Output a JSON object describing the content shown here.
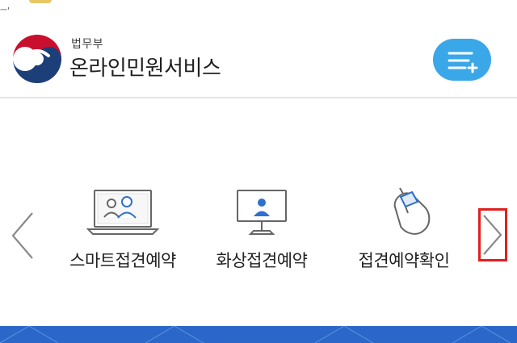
{
  "top_mark": "ㅡ'",
  "header": {
    "org_name": "법무부",
    "service_name": "온라인민원서비스"
  },
  "menu": {
    "items": [
      {
        "label": "스마트접견예약",
        "icon": "laptop-video-call-icon"
      },
      {
        "label": "화상접견예약",
        "icon": "monitor-person-icon"
      },
      {
        "label": "접견예약확인",
        "icon": "mouse-click-icon"
      }
    ]
  },
  "colors": {
    "accent_blue": "#3aa7e8",
    "band_blue": "#2a67c8",
    "highlight_red": "#e01f1f",
    "logo_red": "#c8102e",
    "logo_navy": "#1c3f7a"
  }
}
